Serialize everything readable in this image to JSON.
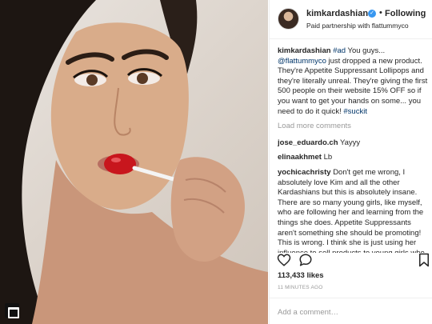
{
  "post": {
    "photo_alt": "Woman with long dark hair holding a red lollipop to her lips",
    "badge_icon": "shopping-bag-icon"
  },
  "header": {
    "username": "kimkardashian",
    "verified_icon": "verified-badge-icon",
    "follow_separator": "•",
    "follow_status": "Following",
    "partnership_text": "Paid partnership with flattummyco"
  },
  "caption": {
    "user": "kimkardashian",
    "hashtag_ad": "#ad",
    "text_part1": " You guys... ",
    "mention": "@flattummyco",
    "text_part2": " just dropped a new product. They're Appetite Suppressant Lollipops and they're literally unreal. They're giving the first 500 people on their website 15% OFF so if you want to get your hands on some... you need to do it quick! ",
    "hashtag_end": "#suckit"
  },
  "load_more_label": "Load more comments",
  "comments": [
    {
      "user": "jose_eduardo.ch",
      "text": "Yayyy"
    },
    {
      "user": "elinaakhmet",
      "text": "Lb"
    },
    {
      "user": "yochicachristy",
      "text": "Don't get me wrong, I absolutely love Kim and all the other Kardashians but this is absolutely insane. There are so many young girls, like myself, who are following her and learning from the things she does. Appetite Suppressants aren't something she should be promoting! This is wrong. I think she is just using her influence to sell products to young girls who look up to her and that is not okay."
    }
  ],
  "actions": {
    "like_icon": "heart-icon",
    "comment_icon": "comment-bubble-icon",
    "save_icon": "bookmark-icon"
  },
  "likes_count": "113,433 likes",
  "timestamp": "11 MINUTES AGO",
  "add_comment_placeholder": "Add a comment…",
  "colors": {
    "link": "#003569",
    "verified": "#3897f0",
    "muted": "#999999",
    "text": "#262626",
    "lollipop": "#c8161d"
  }
}
